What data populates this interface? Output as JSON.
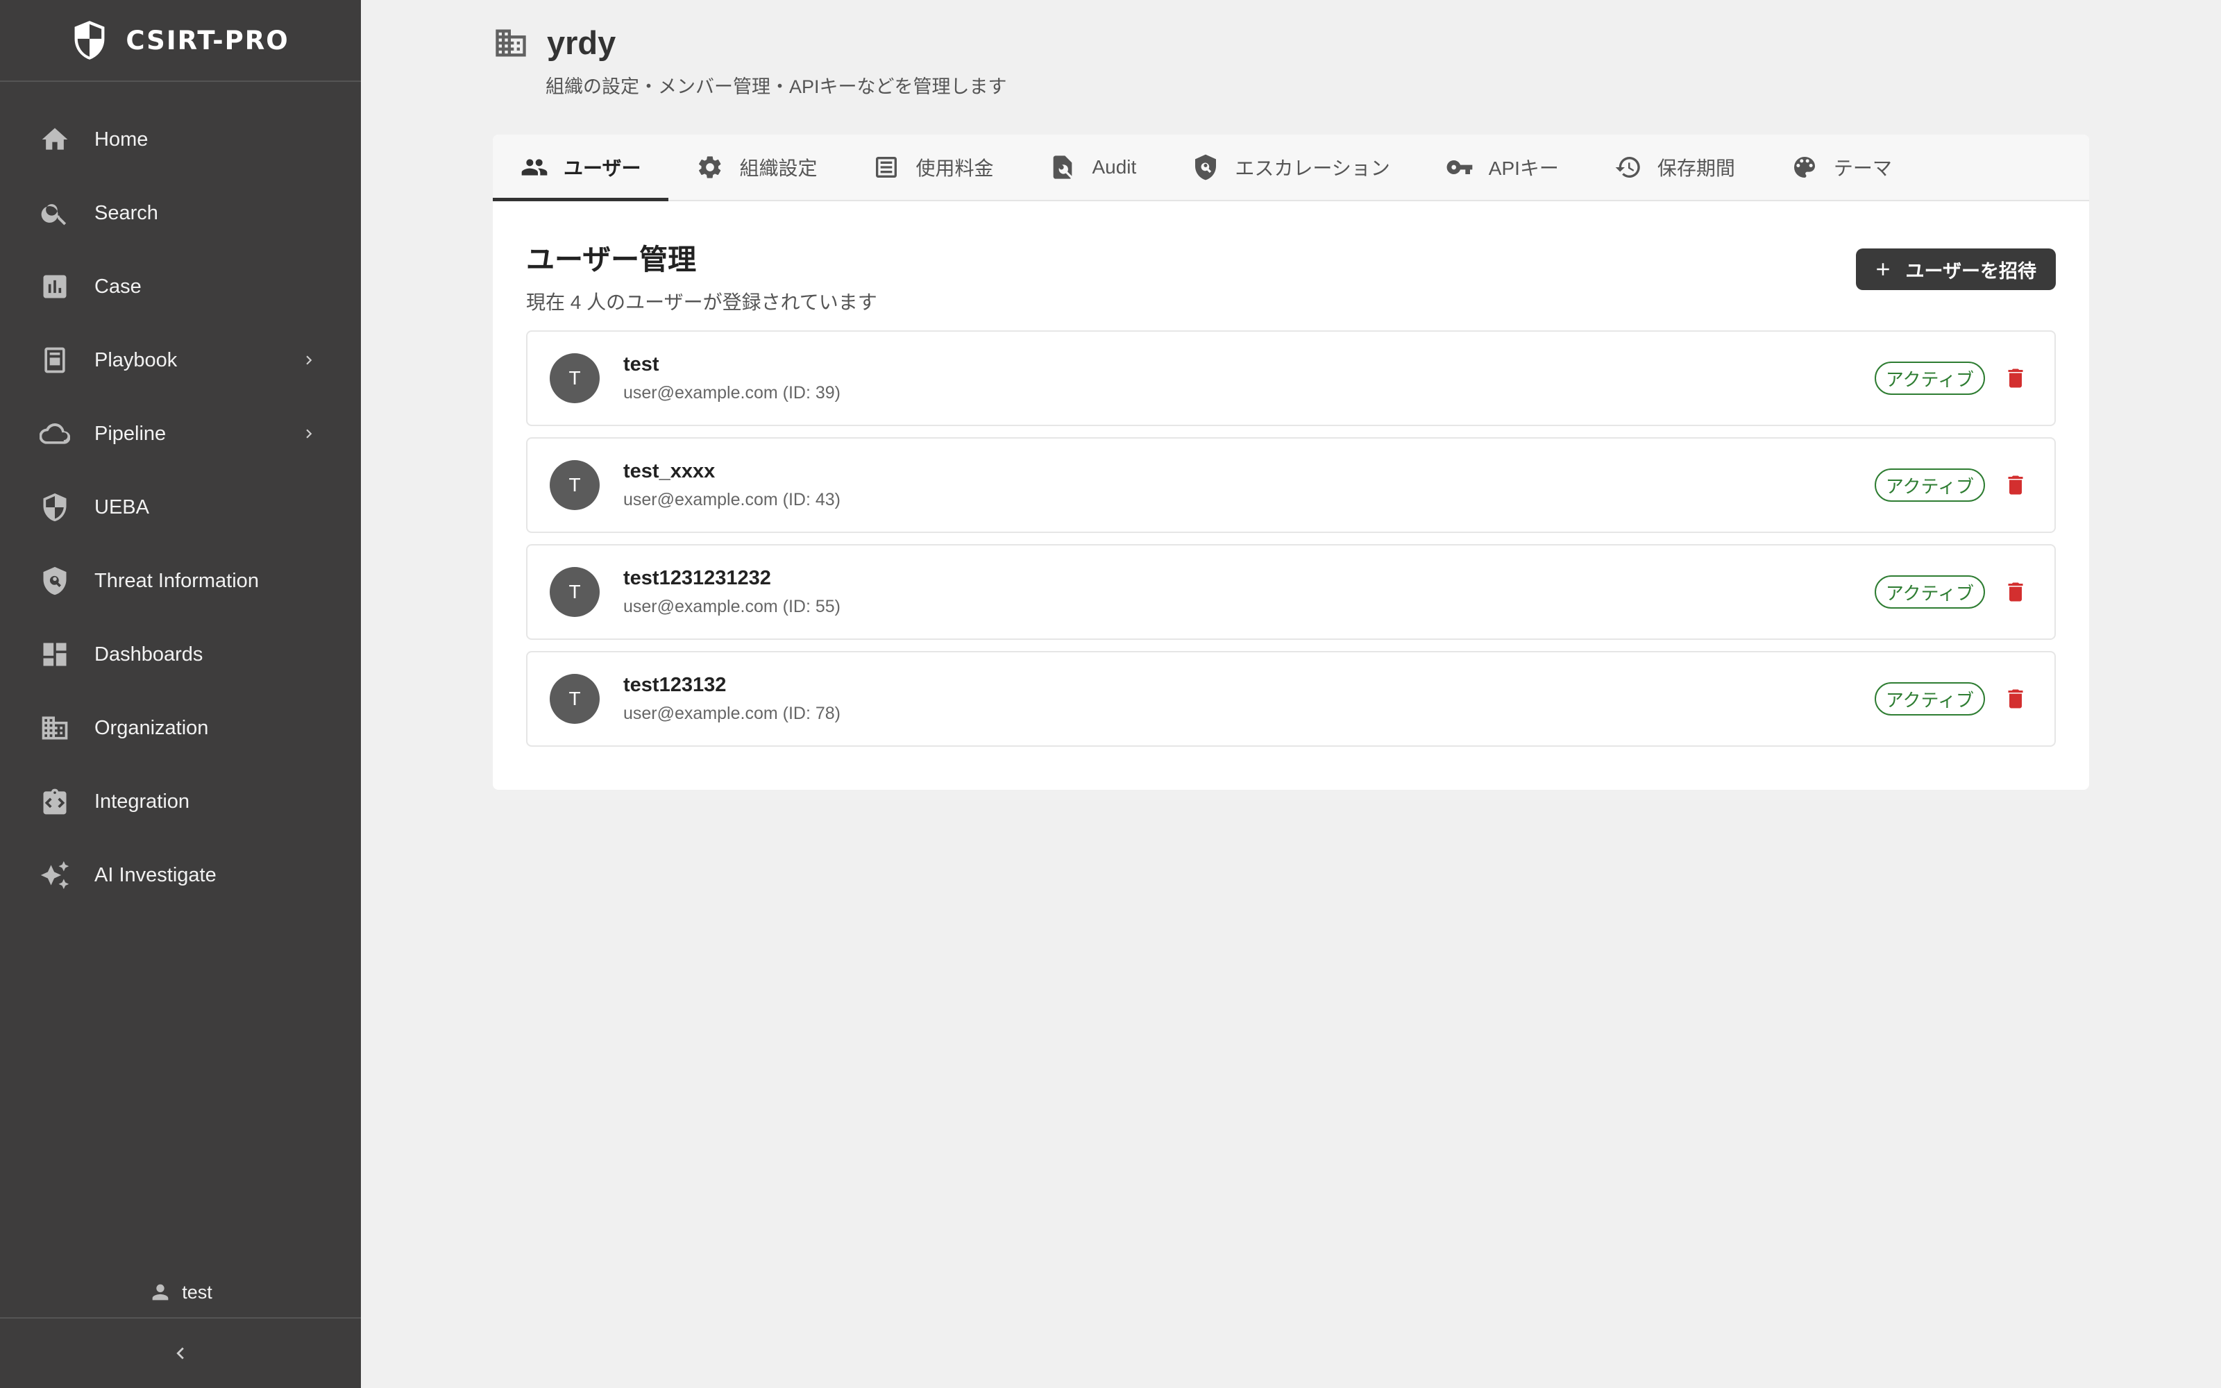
{
  "app": {
    "brand": "CSIRT-PRO"
  },
  "sidebar": {
    "items": [
      {
        "label": "Home",
        "icon": "home-icon"
      },
      {
        "label": "Search",
        "icon": "search-icon"
      },
      {
        "label": "Case",
        "icon": "bar-chart-icon"
      },
      {
        "label": "Playbook",
        "icon": "book-icon",
        "has_submenu": true
      },
      {
        "label": "Pipeline",
        "icon": "cloud-icon",
        "has_submenu": true
      },
      {
        "label": "UEBA",
        "icon": "shield-icon"
      },
      {
        "label": "Threat Information",
        "icon": "shield-search-icon"
      },
      {
        "label": "Dashboards",
        "icon": "dashboard-icon"
      },
      {
        "label": "Organization",
        "icon": "building-icon"
      },
      {
        "label": "Integration",
        "icon": "integration-icon"
      },
      {
        "label": "AI Investigate",
        "icon": "sparkle-icon"
      }
    ],
    "user": "test"
  },
  "org": {
    "name": "yrdy",
    "description": "組織の設定・メンバー管理・APIキーなどを管理します"
  },
  "tabs": [
    {
      "label": "ユーザー",
      "icon": "people-icon",
      "active": true
    },
    {
      "label": "組織設定",
      "icon": "gear-icon"
    },
    {
      "label": "使用料金",
      "icon": "receipt-icon"
    },
    {
      "label": "Audit",
      "icon": "audit-search-icon"
    },
    {
      "label": "エスカレーション",
      "icon": "shield-escalation-icon"
    },
    {
      "label": "APIキー",
      "icon": "key-icon"
    },
    {
      "label": "保存期間",
      "icon": "history-icon"
    },
    {
      "label": "テーマ",
      "icon": "palette-icon"
    }
  ],
  "users_section": {
    "title": "ユーザー管理",
    "subtitle": "現在 4 人のユーザーが登録されています",
    "invite_label": "ユーザーを招待"
  },
  "users": [
    {
      "initial": "T",
      "name": "test",
      "email": "user@example.com (ID: 39)",
      "status": "アクティブ"
    },
    {
      "initial": "T",
      "name": "test_xxxx",
      "email": "user@example.com (ID: 43)",
      "status": "アクティブ"
    },
    {
      "initial": "T",
      "name": "test1231231232",
      "email": "user@example.com (ID: 55)",
      "status": "アクティブ"
    },
    {
      "initial": "T",
      "name": "test123132",
      "email": "user@example.com (ID: 78)",
      "status": "アクティブ"
    }
  ],
  "colors": {
    "sidebar_bg": "#3e3d3d",
    "status_green": "#2e7d32",
    "delete_red": "#d32f2f",
    "page_bg": "#f0f0f0"
  }
}
